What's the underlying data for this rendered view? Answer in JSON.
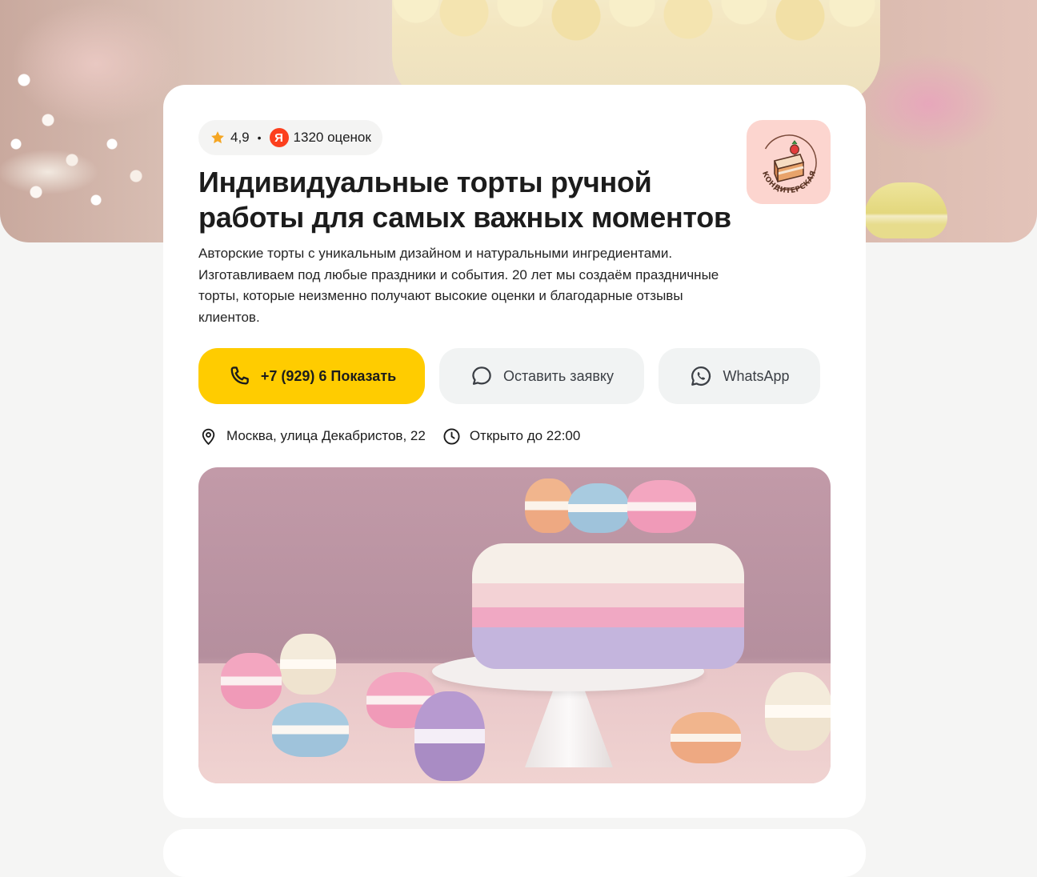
{
  "rating": {
    "score": "4,9",
    "separator": "•",
    "source_letter": "Я",
    "reviews": "1320 оценок"
  },
  "logo": {
    "text": "КОНДИТЕРСКАЯ"
  },
  "title_lines": [
    "Индивидуальные торты ручной",
    "работы для самых важных моментов"
  ],
  "description": "Авторские торты с уникальным дизайном и натуральными ингредиентами. Изготавливаем под любые праздники и события. 20 лет мы создаём праздничные торты, которые неизменно получают высокие оценки и благодарные отзывы клиентов.",
  "buttons": {
    "call": "+7 (929) 6 Показать",
    "request": "Оставить заявку",
    "whatsapp": "WhatsApp"
  },
  "info": {
    "address": "Москва, улица Декабристов, 22",
    "hours": "Открыто до 22:00"
  },
  "colors": {
    "accent_yellow": "#ffcc00",
    "star_orange": "#f5a623",
    "yandex_red": "#fc3f1d",
    "logo_bg": "#fcd5cf"
  },
  "icons": {
    "rating": "star-icon",
    "source": "yandex-icon",
    "call": "phone-icon",
    "request": "chat-bubble-icon",
    "whatsapp": "whatsapp-icon",
    "address": "location-pin-icon",
    "hours": "clock-icon"
  }
}
